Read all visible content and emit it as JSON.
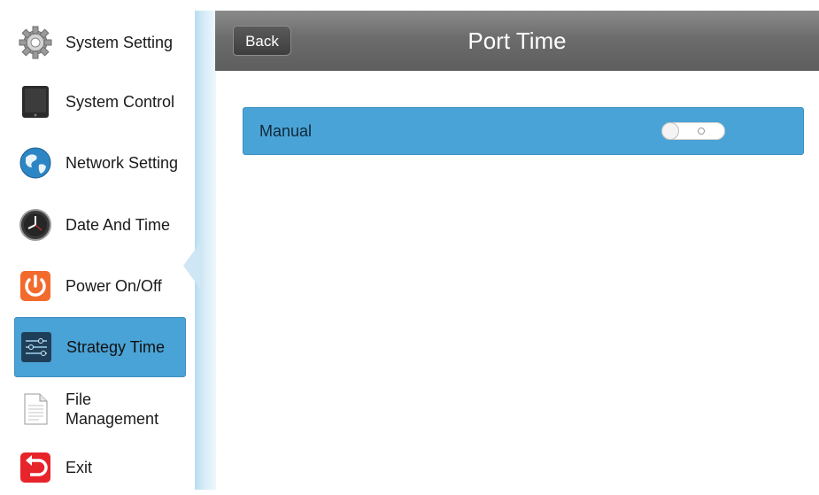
{
  "sidebar": {
    "items": [
      {
        "label": "System Setting",
        "icon": "gear-icon"
      },
      {
        "label": "System Control",
        "icon": "tablet-icon"
      },
      {
        "label": "Network Setting",
        "icon": "globe-icon"
      },
      {
        "label": "Date And Time",
        "icon": "clock-icon"
      },
      {
        "label": "Power On/Off",
        "icon": "power-icon"
      },
      {
        "label": "Strategy Time",
        "icon": "sliders-icon",
        "active": true
      },
      {
        "label": "File\nManagement",
        "icon": "document-icon"
      },
      {
        "label": "Exit",
        "icon": "exit-icon"
      }
    ]
  },
  "header": {
    "back_label": "Back",
    "title": "Port Time"
  },
  "settings": {
    "manual": {
      "label": "Manual",
      "toggle_on": false
    }
  },
  "colors": {
    "accent": "#4aa3d6",
    "header": "#6c6c6c",
    "divider": "#cfe6f4"
  }
}
